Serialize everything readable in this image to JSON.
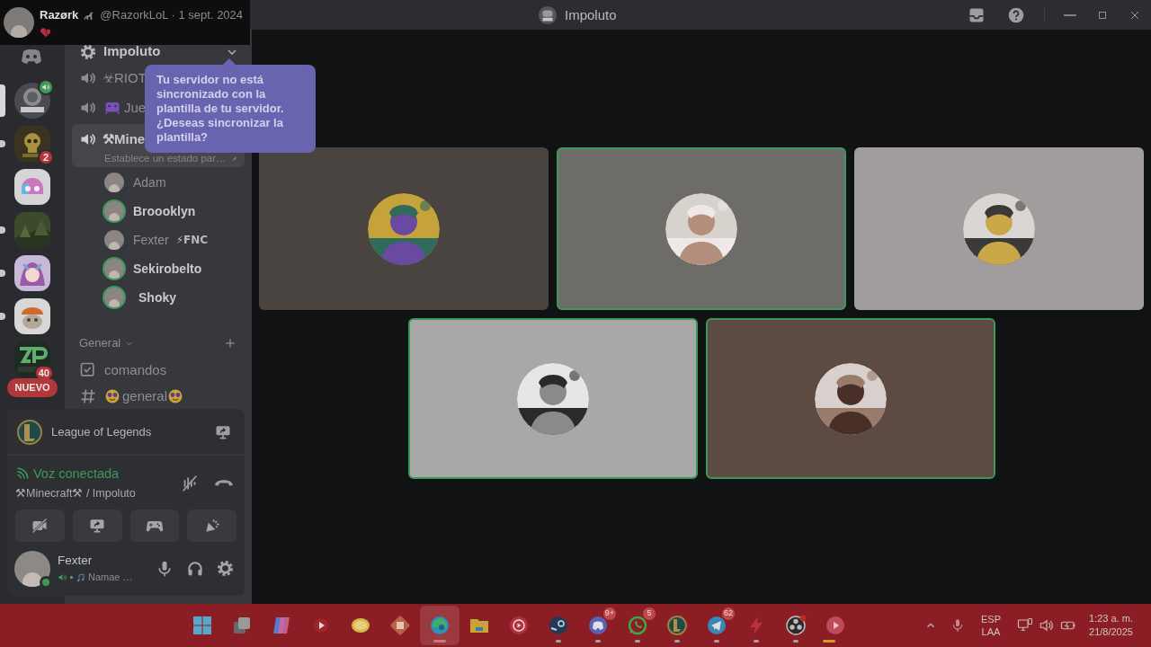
{
  "tweet": {
    "author": "Razørk",
    "handle": "@RazorkLoL · 1 sept. 2024"
  },
  "window": {
    "title": "Impoluto"
  },
  "servers": [
    {
      "kind": "home",
      "selected": false,
      "unread": false,
      "in_voice": false
    },
    {
      "kind": "impoluto",
      "selected": true,
      "unread": false,
      "in_voice": true
    },
    {
      "kind": "skull",
      "selected": false,
      "unread": true,
      "in_voice": false,
      "badge": "2"
    },
    {
      "kind": "mascot",
      "selected": false,
      "unread": false,
      "in_voice": false
    },
    {
      "kind": "forest",
      "selected": false,
      "unread": true,
      "in_voice": false
    },
    {
      "kind": "anime",
      "selected": false,
      "unread": true,
      "in_voice": false
    },
    {
      "kind": "meme",
      "selected": false,
      "unread": true,
      "in_voice": false
    },
    {
      "kind": "letters",
      "selected": false,
      "unread": false,
      "in_voice": false,
      "badge": "40"
    }
  ],
  "new_badge": "NUEVO",
  "server_header": {
    "name": "Impoluto"
  },
  "tooltip": "Tu servidor no está sincronizado con la plantilla de tu servidor. ¿Deseas sincronizar la plantilla?",
  "voice_channels": [
    {
      "name": "☣RIOT",
      "selected": false,
      "icon": false
    },
    {
      "name": "Jue",
      "selected": false,
      "icon": true
    },
    {
      "name": "⚒Mine",
      "selected": true,
      "icon": false,
      "status": "Establece un estado par…"
    }
  ],
  "members": [
    {
      "name": "Adam",
      "speaking": false
    },
    {
      "name": "Broooklyn",
      "speaking": true
    },
    {
      "name": "Fexter",
      "speaking": false,
      "tag": "⚡FNC"
    },
    {
      "name": "Sekirobelto",
      "speaking": true
    },
    {
      "name": "Shoky",
      "speaking": true
    }
  ],
  "category": {
    "name": "General",
    "expanded": true
  },
  "text_channels": [
    {
      "kind": "forum",
      "name": "comandos"
    },
    {
      "kind": "text",
      "name": "general"
    }
  ],
  "activity": {
    "name": "League of Legends"
  },
  "voice": {
    "status": "Voz conectada",
    "location": "⚒Minecraft⚒ / Impoluto"
  },
  "voice_buttons": [
    {
      "kind": "camera-off"
    },
    {
      "kind": "screenshare"
    },
    {
      "kind": "activities"
    },
    {
      "kind": "soundboard"
    }
  ],
  "user": {
    "name": "Fexter",
    "status": "Namae …",
    "online": true
  },
  "tiles": [
    {
      "color": "#4a4440",
      "speaking": false
    },
    {
      "color": "#6e6c68",
      "speaking": true
    },
    {
      "color": "#a29d9d",
      "speaking": false
    },
    {
      "color": "#a8a8a8",
      "speaking": true
    },
    {
      "color": "#5d4a43",
      "speaking": true
    }
  ],
  "taskbar": {
    "apps": [
      {
        "kind": "windows",
        "running": false,
        "active": false,
        "attention": false
      },
      {
        "kind": "taskview",
        "running": false,
        "active": false,
        "attention": false
      },
      {
        "kind": "copilot",
        "running": false,
        "active": false,
        "attention": false
      },
      {
        "kind": "youtube",
        "running": false,
        "active": false,
        "attention": false
      },
      {
        "kind": "lemon",
        "running": false,
        "active": false,
        "attention": false
      },
      {
        "kind": "game",
        "running": false,
        "active": false,
        "attention": false
      },
      {
        "kind": "edge",
        "running": true,
        "active": true,
        "attention": false
      },
      {
        "kind": "folder",
        "running": false,
        "active": false,
        "attention": false
      },
      {
        "kind": "music",
        "running": false,
        "active": false,
        "attention": false
      },
      {
        "kind": "steam",
        "running": true,
        "active": false,
        "attention": false
      },
      {
        "kind": "discord",
        "running": true,
        "active": false,
        "attention": false,
        "badge": "9+"
      },
      {
        "kind": "whatsapp",
        "running": true,
        "active": false,
        "attention": false,
        "badge": "5"
      },
      {
        "kind": "lol",
        "running": true,
        "active": false,
        "attention": false
      },
      {
        "kind": "telegram",
        "running": true,
        "active": false,
        "attention": false,
        "badge": "62"
      },
      {
        "kind": "lightning",
        "running": true,
        "active": false,
        "attention": false
      },
      {
        "kind": "obs",
        "running": true,
        "active": false,
        "attention": false
      },
      {
        "kind": "player",
        "running": true,
        "active": false,
        "attention": true
      }
    ],
    "tray": {
      "language": "ESP",
      "layout": "LAA",
      "time": "1:23 a. m.",
      "date": "21/8/2025"
    }
  }
}
